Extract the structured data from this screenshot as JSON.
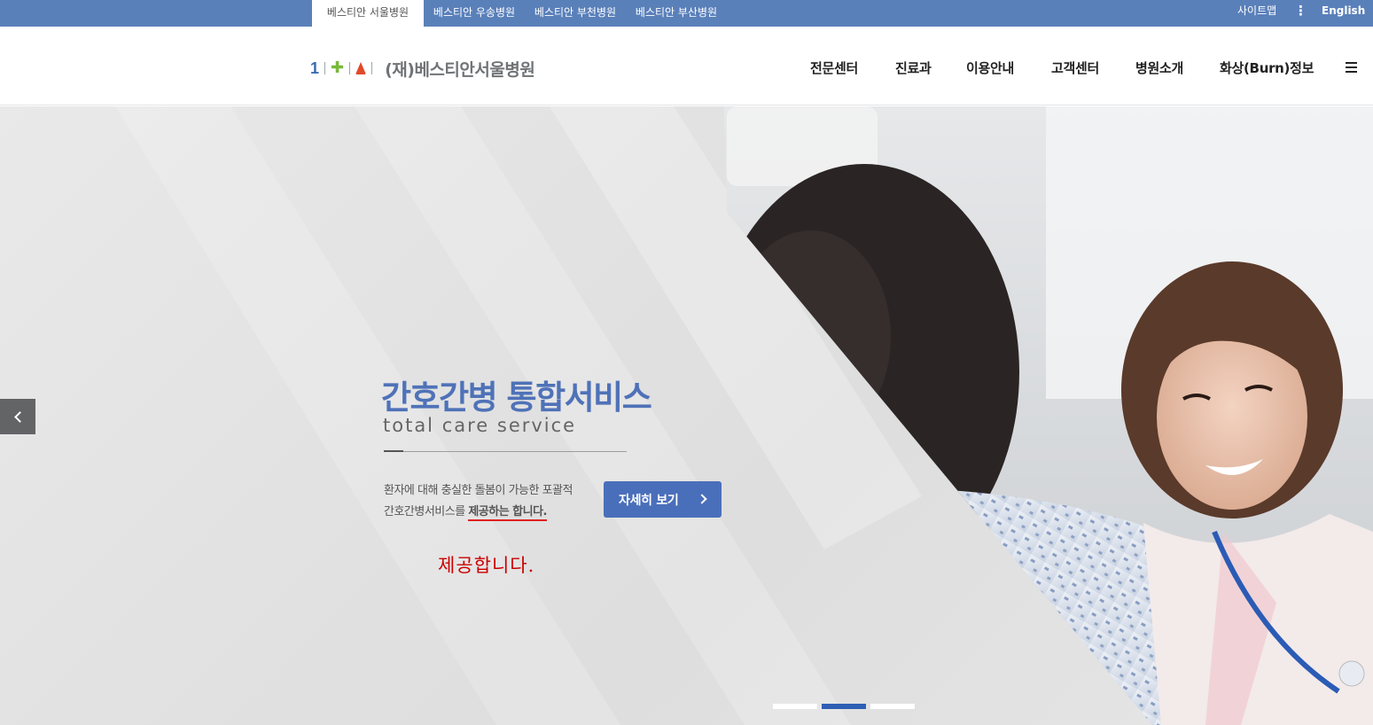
{
  "topbar": {
    "tabs": [
      {
        "label": "베스티안 서울병원",
        "active": true
      },
      {
        "label": "베스티안 우송병원",
        "active": false
      },
      {
        "label": "베스티안 부천병원",
        "active": false
      },
      {
        "label": "베스티안 부산병원",
        "active": false
      }
    ],
    "sitemap_label": "사이트맵",
    "more_label": "⋮",
    "english_label": "English"
  },
  "header": {
    "logo_number": "1",
    "logo_name": "(재)베스티안서울병원",
    "nav": [
      "전문센터",
      "진료과",
      "이용안내",
      "고객센터",
      "병원소개",
      "화상(Burn)정보"
    ]
  },
  "hero": {
    "title": "간호간병 통합서비스",
    "subtitle": "total care service",
    "desc_line1": "환자에 대해 충실한 돌봄이 가능한 포괄적",
    "desc_line2_plain": "간호간병서비스를 ",
    "desc_line2_underlined": "제공하는 합니다.",
    "detail_button": "자세히 보기",
    "annotation": "제공합니다.",
    "slide_count": 3,
    "active_slide": 2
  },
  "colors": {
    "topbar_bg": "#5a80ba",
    "accent_blue": "#4a6fba",
    "title_blue": "#4f72b8",
    "pager_active": "#2e5fb5",
    "annotation_red": "#cc0000"
  },
  "icons": {
    "prev": "chevron-left-icon",
    "detail": "chevron-right-icon",
    "menu": "hamburger-icon"
  }
}
